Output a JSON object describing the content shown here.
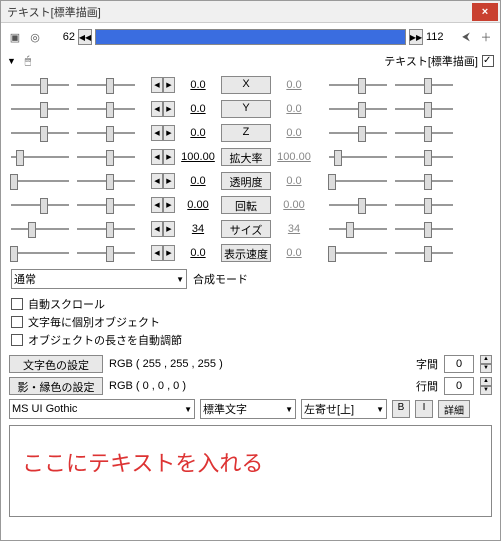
{
  "title": "テキスト[標準描画]",
  "frame": {
    "start": "62",
    "end": "112"
  },
  "header_label": "テキスト[標準描画]",
  "params": [
    {
      "v": "0.0",
      "label": "X",
      "v2": "0.0",
      "sl": "50%",
      "sr": "50%"
    },
    {
      "v": "0.0",
      "label": "Y",
      "v2": "0.0",
      "sl": "50%",
      "sr": "50%"
    },
    {
      "v": "0.0",
      "label": "Z",
      "v2": "0.0",
      "sl": "50%",
      "sr": "50%"
    },
    {
      "v": "100.00",
      "label": "拡大率",
      "v2": "100.00",
      "sl": "12%",
      "sr": "12%"
    },
    {
      "v": "0.0",
      "label": "透明度",
      "v2": "0.0",
      "sl": "2%",
      "sr": "2%"
    },
    {
      "v": "0.00",
      "label": "回転",
      "v2": "0.00",
      "sl": "50%",
      "sr": "50%"
    },
    {
      "v": "34",
      "label": "サイズ",
      "v2": "34",
      "sl": "30%",
      "sr": "30%"
    },
    {
      "v": "0.0",
      "label": "表示速度",
      "v2": "0.0",
      "sl": "2%",
      "sr": "2%"
    }
  ],
  "blend": {
    "value": "通常",
    "label": "合成モード"
  },
  "checks": [
    "自動スクロール",
    "文字毎に個別オブジェクト",
    "オブジェクトの長さを自動調節"
  ],
  "color1": {
    "btn": "文字色の設定",
    "rgb": "RGB ( 255 , 255 , 255 )"
  },
  "color2": {
    "btn": "影・縁色の設定",
    "rgb": "RGB ( 0 , 0 , 0 )"
  },
  "spacing": {
    "char_l": "字間",
    "char_v": "0",
    "line_l": "行間",
    "line_v": "0"
  },
  "font": {
    "name": "MS UI Gothic",
    "type": "標準文字",
    "align": "左寄せ[上]",
    "b": "B",
    "i": "I",
    "detail": "詳細"
  },
  "textbox": "ここにテキストを入れる"
}
